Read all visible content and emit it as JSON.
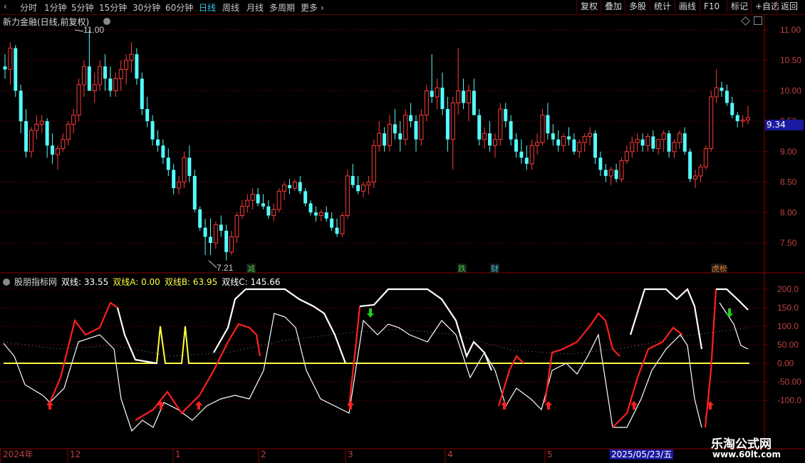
{
  "toolbar": {
    "tabs": [
      "分时",
      "1分钟",
      "5分钟",
      "15分钟",
      "30分钟",
      "60分钟",
      "日线",
      "周线",
      "月线",
      "多周期",
      "更多"
    ],
    "active_tab": "日线",
    "right_buttons": [
      "复权",
      "叠加",
      "多股",
      "统计",
      "画线",
      "F10",
      "标记",
      "+自选",
      "返回"
    ]
  },
  "main_chart": {
    "title": "新力金融(日线,前复权)",
    "high_label": "11.00",
    "low_label": "7.21",
    "current_price": "9.34",
    "y_ticks": [
      "11.00",
      "10.50",
      "10.00",
      "9.50",
      "9.00",
      "8.50",
      "8.00",
      "7.50"
    ],
    "events": [
      {
        "label": "减",
        "color": "#3cc83c"
      },
      {
        "label": "跌",
        "color": "#3cc83c"
      },
      {
        "label": "财",
        "color": "#39c5e6"
      },
      {
        "label": "龙虎榜",
        "color": "#e08030"
      }
    ]
  },
  "indicator": {
    "name": "股朋指标网",
    "items": [
      {
        "label": "双线: 33.55",
        "color": "#ffffff"
      },
      {
        "label": "双线A: 0.00",
        "color": "#ffff40"
      },
      {
        "label": "双线B: 63.95",
        "color": "#ffff40"
      },
      {
        "label": "双线C: 145.66",
        "color": "#ffffff"
      }
    ],
    "y_ticks": [
      "200.0",
      "150.0",
      "100.0",
      "50.00",
      "0.00",
      "-50.00",
      "-100.0"
    ]
  },
  "x_axis": {
    "labels": [
      "2024年",
      "12",
      "1",
      "2",
      "3",
      "4",
      "5"
    ],
    "highlight_date": "2025/05/23/五"
  },
  "watermark": {
    "text": "乐淘公式网",
    "url": "www.60lt.com"
  },
  "chart_data": {
    "type": "candlestick",
    "title": "新力金融(日线,前复权)",
    "ylim": [
      7.2,
      11.1
    ],
    "ohlc": [
      [
        10.4,
        10.6,
        10.2,
        10.35
      ],
      [
        10.35,
        10.8,
        10.1,
        10.7
      ],
      [
        10.7,
        10.75,
        9.9,
        10.0
      ],
      [
        10.0,
        10.1,
        9.3,
        9.5
      ],
      [
        9.5,
        9.7,
        8.9,
        9.0
      ],
      [
        9.0,
        9.4,
        8.9,
        9.35
      ],
      [
        9.35,
        9.6,
        9.2,
        9.45
      ],
      [
        9.45,
        9.6,
        9.3,
        9.5
      ],
      [
        9.5,
        9.55,
        8.9,
        9.1
      ],
      [
        9.1,
        9.3,
        8.8,
        8.95
      ],
      [
        8.95,
        9.1,
        8.7,
        9.05
      ],
      [
        9.05,
        9.3,
        9.0,
        9.2
      ],
      [
        9.2,
        9.5,
        9.1,
        9.45
      ],
      [
        9.45,
        9.7,
        9.3,
        9.6
      ],
      [
        9.6,
        10.2,
        9.5,
        10.1
      ],
      [
        10.1,
        10.5,
        9.9,
        10.4
      ],
      [
        10.4,
        11.0,
        10.2,
        10.0
      ],
      [
        10.0,
        10.3,
        9.8,
        10.1
      ],
      [
        10.1,
        10.5,
        10.0,
        10.4
      ],
      [
        10.4,
        10.6,
        10.0,
        10.2
      ],
      [
        10.2,
        10.4,
        9.9,
        10.0
      ],
      [
        10.0,
        10.3,
        9.9,
        10.2
      ],
      [
        10.2,
        10.5,
        10.0,
        10.35
      ],
      [
        10.35,
        10.6,
        10.1,
        10.5
      ],
      [
        10.5,
        10.8,
        10.3,
        10.6
      ],
      [
        10.6,
        10.7,
        10.1,
        10.2
      ],
      [
        10.2,
        10.3,
        9.6,
        9.7
      ],
      [
        9.7,
        9.9,
        9.4,
        9.5
      ],
      [
        9.5,
        9.6,
        9.1,
        9.2
      ],
      [
        9.2,
        9.35,
        9.0,
        9.1
      ],
      [
        9.1,
        9.2,
        8.8,
        8.9
      ],
      [
        8.9,
        9.05,
        8.6,
        8.7
      ],
      [
        8.7,
        8.8,
        8.3,
        8.4
      ],
      [
        8.4,
        8.6,
        8.3,
        8.5
      ],
      [
        8.5,
        9.0,
        8.4,
        8.9
      ],
      [
        8.9,
        9.1,
        8.5,
        8.6
      ],
      [
        8.6,
        8.7,
        8.0,
        8.05
      ],
      [
        8.05,
        8.1,
        7.7,
        7.75
      ],
      [
        7.75,
        7.9,
        7.3,
        7.6
      ],
      [
        7.6,
        7.9,
        7.3,
        7.5
      ],
      [
        7.5,
        7.85,
        7.4,
        7.8
      ],
      [
        7.8,
        7.95,
        7.6,
        7.7
      ],
      [
        7.7,
        7.8,
        7.21,
        7.35
      ],
      [
        7.35,
        7.7,
        7.3,
        7.6
      ],
      [
        7.6,
        8.0,
        7.5,
        7.95
      ],
      [
        7.95,
        8.2,
        7.9,
        8.1
      ],
      [
        8.1,
        8.3,
        8.0,
        8.2
      ],
      [
        8.2,
        8.4,
        8.05,
        8.3
      ],
      [
        8.3,
        8.4,
        8.1,
        8.15
      ],
      [
        8.15,
        8.3,
        8.05,
        8.1
      ],
      [
        8.1,
        8.2,
        7.9,
        7.95
      ],
      [
        7.95,
        8.15,
        7.85,
        8.05
      ],
      [
        8.05,
        8.4,
        8.0,
        8.35
      ],
      [
        8.35,
        8.5,
        8.2,
        8.45
      ],
      [
        8.45,
        8.55,
        8.3,
        8.4
      ],
      [
        8.4,
        8.55,
        8.35,
        8.5
      ],
      [
        8.5,
        8.6,
        8.3,
        8.35
      ],
      [
        8.35,
        8.4,
        8.1,
        8.15
      ],
      [
        8.15,
        8.2,
        7.95,
        8.0
      ],
      [
        8.0,
        8.1,
        7.85,
        7.95
      ],
      [
        7.95,
        8.05,
        7.85,
        8.0
      ],
      [
        8.0,
        8.1,
        7.85,
        7.9
      ],
      [
        7.9,
        8.0,
        7.7,
        7.75
      ],
      [
        7.75,
        7.9,
        7.6,
        7.65
      ],
      [
        7.65,
        8.0,
        7.6,
        7.95
      ],
      [
        7.95,
        8.7,
        7.9,
        8.6
      ],
      [
        8.6,
        8.8,
        8.4,
        8.45
      ],
      [
        8.45,
        8.6,
        8.3,
        8.35
      ],
      [
        8.35,
        8.5,
        8.25,
        8.45
      ],
      [
        8.45,
        8.6,
        8.3,
        8.5
      ],
      [
        8.5,
        9.2,
        8.4,
        9.1
      ],
      [
        9.1,
        9.5,
        9.0,
        9.3
      ],
      [
        9.3,
        9.4,
        9.0,
        9.1
      ],
      [
        9.1,
        9.6,
        9.0,
        9.45
      ],
      [
        9.45,
        9.7,
        9.2,
        9.3
      ],
      [
        9.3,
        9.5,
        9.0,
        9.2
      ],
      [
        9.2,
        9.7,
        9.1,
        9.6
      ],
      [
        9.6,
        9.8,
        9.4,
        9.5
      ],
      [
        9.5,
        9.6,
        9.0,
        9.2
      ],
      [
        9.2,
        9.7,
        9.1,
        9.6
      ],
      [
        9.6,
        10.1,
        9.5,
        10.0
      ],
      [
        10.0,
        10.6,
        9.8,
        9.9
      ],
      [
        9.9,
        10.2,
        9.7,
        10.05
      ],
      [
        10.05,
        10.3,
        9.6,
        9.7
      ],
      [
        9.7,
        9.9,
        9.0,
        9.2
      ],
      [
        9.2,
        9.9,
        8.7,
        9.8
      ],
      [
        9.8,
        10.7,
        9.6,
        10.0
      ],
      [
        10.0,
        10.2,
        9.7,
        9.8
      ],
      [
        9.8,
        10.1,
        9.5,
        10.0
      ],
      [
        10.0,
        10.2,
        9.6,
        9.6
      ],
      [
        9.6,
        9.7,
        9.1,
        9.2
      ],
      [
        9.2,
        9.4,
        9.05,
        9.3
      ],
      [
        9.3,
        9.5,
        9.0,
        9.1
      ],
      [
        9.1,
        9.3,
        8.9,
        9.2
      ],
      [
        9.2,
        9.8,
        9.1,
        9.7
      ],
      [
        9.7,
        9.8,
        9.4,
        9.5
      ],
      [
        9.5,
        9.6,
        9.1,
        9.2
      ],
      [
        9.2,
        9.3,
        8.9,
        9.0
      ],
      [
        9.0,
        9.2,
        8.8,
        8.9
      ],
      [
        8.9,
        9.1,
        8.7,
        8.8
      ],
      [
        8.8,
        9.2,
        8.7,
        9.1
      ],
      [
        9.1,
        9.3,
        8.95,
        9.15
      ],
      [
        9.15,
        9.7,
        9.1,
        9.6
      ],
      [
        9.6,
        9.8,
        9.2,
        9.3
      ],
      [
        9.3,
        9.45,
        9.1,
        9.2
      ],
      [
        9.2,
        9.35,
        9.0,
        9.1
      ],
      [
        9.1,
        9.3,
        9.0,
        9.25
      ],
      [
        9.25,
        9.4,
        9.1,
        9.2
      ],
      [
        9.2,
        9.3,
        8.95,
        9.0
      ],
      [
        9.0,
        9.2,
        8.9,
        9.15
      ],
      [
        9.15,
        9.3,
        9.0,
        9.25
      ],
      [
        9.25,
        9.4,
        9.1,
        9.3
      ],
      [
        9.3,
        9.35,
        8.8,
        8.9
      ],
      [
        8.9,
        9.0,
        8.6,
        8.7
      ],
      [
        8.7,
        8.8,
        8.5,
        8.6
      ],
      [
        8.6,
        8.75,
        8.45,
        8.7
      ],
      [
        8.7,
        8.8,
        8.5,
        8.55
      ],
      [
        8.55,
        8.9,
        8.5,
        8.85
      ],
      [
        8.85,
        9.1,
        8.8,
        9.0
      ],
      [
        9.0,
        9.25,
        8.9,
        9.15
      ],
      [
        9.15,
        9.3,
        9.0,
        9.2
      ],
      [
        9.2,
        9.3,
        9.0,
        9.1
      ],
      [
        9.1,
        9.3,
        9.0,
        9.25
      ],
      [
        9.25,
        9.35,
        9.0,
        9.05
      ],
      [
        9.05,
        9.2,
        8.95,
        9.2
      ],
      [
        9.2,
        9.35,
        9.0,
        9.3
      ],
      [
        9.3,
        9.35,
        8.9,
        9.0
      ],
      [
        9.0,
        9.2,
        8.9,
        9.15
      ],
      [
        9.15,
        9.35,
        9.05,
        9.3
      ],
      [
        9.3,
        9.4,
        8.95,
        9.0
      ],
      [
        9.0,
        9.05,
        8.5,
        8.55
      ],
      [
        8.55,
        8.7,
        8.4,
        8.6
      ],
      [
        8.6,
        8.8,
        8.5,
        8.75
      ],
      [
        8.75,
        9.1,
        8.7,
        9.05
      ],
      [
        9.05,
        10.0,
        9.0,
        9.9
      ],
      [
        9.9,
        10.35,
        9.8,
        10.05
      ],
      [
        10.05,
        10.15,
        9.9,
        10.0
      ],
      [
        10.0,
        10.1,
        9.75,
        9.8
      ],
      [
        9.8,
        9.9,
        9.55,
        9.6
      ],
      [
        9.6,
        9.65,
        9.4,
        9.5
      ],
      [
        9.5,
        9.6,
        9.4,
        9.52
      ],
      [
        9.52,
        9.75,
        9.45,
        9.56
      ]
    ]
  }
}
